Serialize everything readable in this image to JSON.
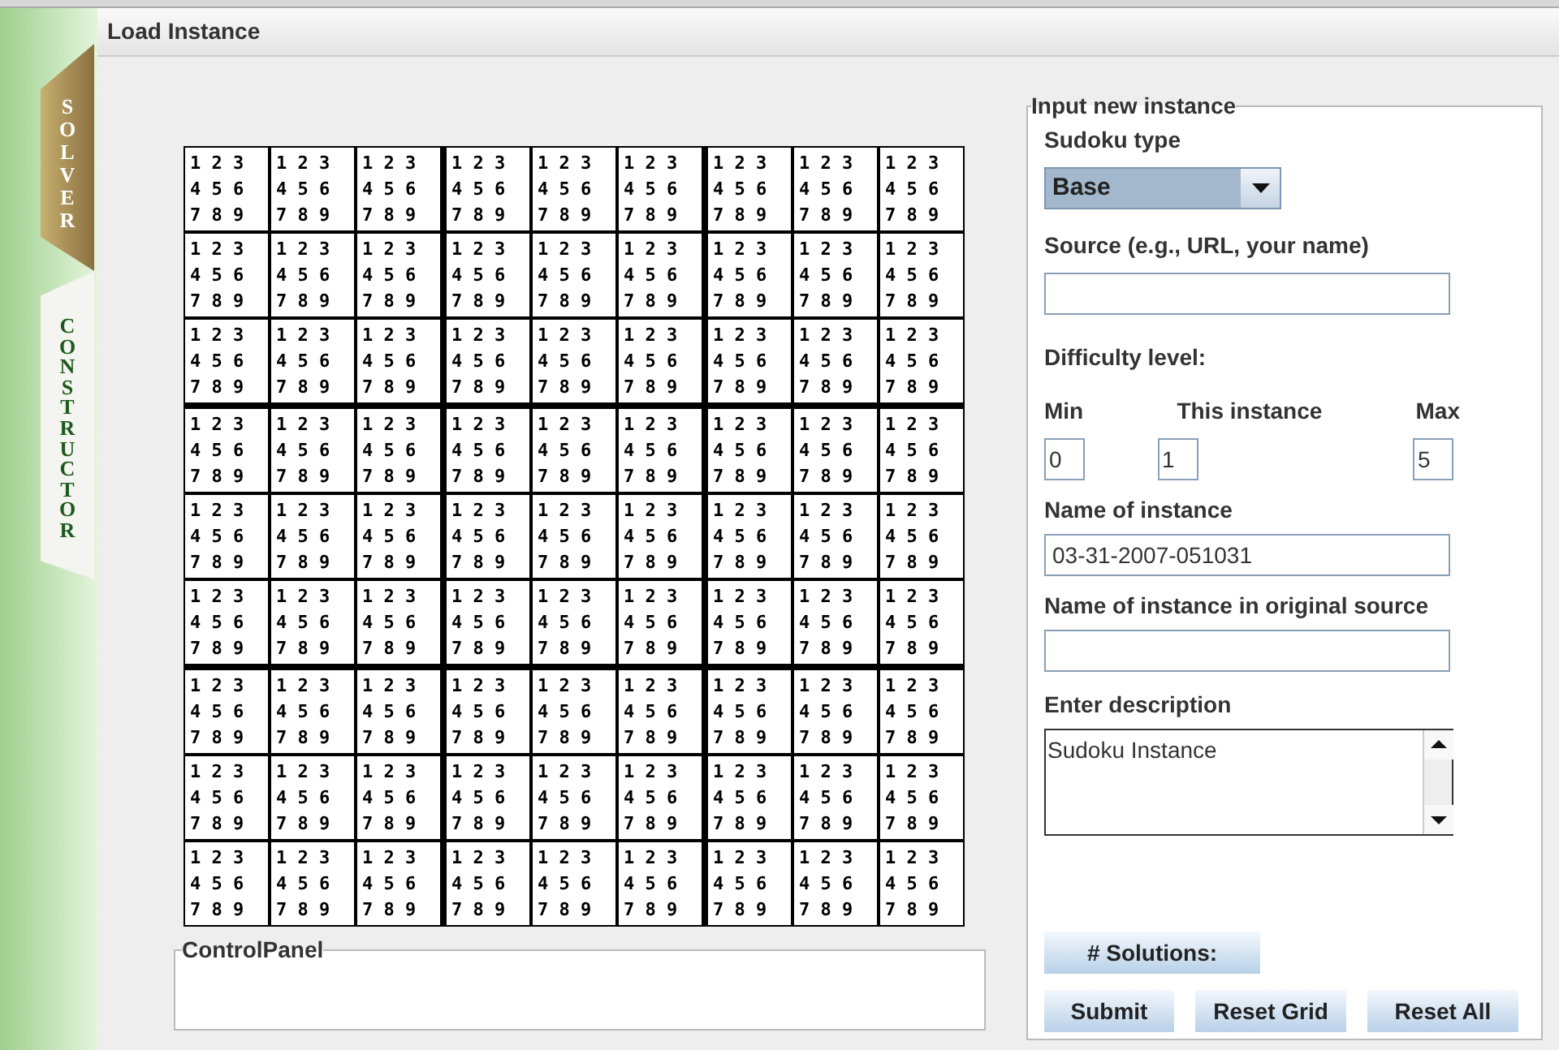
{
  "tabs": [
    {
      "label": "SOLVER",
      "selected": true
    },
    {
      "label": "CONSTRUCTOR",
      "selected": false
    }
  ],
  "header": {
    "title": "Load Instance"
  },
  "grid": {
    "rows": [
      [
        [
          "1 2 3",
          "4 5 6",
          "7 8 9"
        ],
        [
          "1 2 3",
          "4 5 6",
          "7 8 9"
        ],
        [
          "1 2 3",
          "4 5 6",
          "7 8 9"
        ],
        [
          "1 2 3",
          "4 5 6",
          "7 8 9"
        ],
        [
          "1 2 3",
          "4 5 6",
          "7 8 9"
        ],
        [
          "1 2 3",
          "4 5 6",
          "7 8 9"
        ],
        [
          "1 2 3",
          "4 5 6",
          "7 8 9"
        ],
        [
          "1 2 3",
          "4 5 6",
          "7 8 9"
        ],
        [
          "1 2 3",
          "4 5 6",
          "7 8 9"
        ]
      ],
      [
        [
          "1 2 3",
          "4 5 6",
          "7 8 9"
        ],
        [
          "1 2 3",
          "4 5 6",
          "7 8 9"
        ],
        [
          "1 2 3",
          "4 5 6",
          "7 8 9"
        ],
        [
          "1 2 3",
          "4 5 6",
          "7 8 9"
        ],
        [
          "1 2 3",
          "4 5 6",
          "7 8 9"
        ],
        [
          "1 2 3",
          "4 5 6",
          "7 8 9"
        ],
        [
          "1 2 3",
          "4 5 6",
          "7 8 9"
        ],
        [
          "1 2 3",
          "4 5 6",
          "7 8 9"
        ],
        [
          "1 2 3",
          "4 5 6",
          "7 8 9"
        ]
      ],
      [
        [
          "1 2 3",
          "4 5 6",
          "7 8 9"
        ],
        [
          "1 2 3",
          "4 5 6",
          "7 8 9"
        ],
        [
          "1 2 3",
          "4 5 6",
          "7 8 9"
        ],
        [
          "1 2 3",
          "4 5 6",
          "7 8 9"
        ],
        [
          "1 2 3",
          "4 5 6",
          "7 8 9"
        ],
        [
          "1 2 3",
          "4 5 6",
          "7 8 9"
        ],
        [
          "1 2 3",
          "4 5 6",
          "7 8 9"
        ],
        [
          "1 2 3",
          "4 5 6",
          "7 8 9"
        ],
        [
          "1 2 3",
          "4 5 6",
          "7 8 9"
        ]
      ],
      [
        [
          "1 2 3",
          "4 5 6",
          "7 8 9"
        ],
        [
          "1 2 3",
          "4 5 6",
          "7 8 9"
        ],
        [
          "1 2 3",
          "4 5 6",
          "7 8 9"
        ],
        [
          "1 2 3",
          "4 5 6",
          "7 8 9"
        ],
        [
          "1 2 3",
          "4 5 6",
          "7 8 9"
        ],
        [
          "1 2 3",
          "4 5 6",
          "7 8 9"
        ],
        [
          "1 2 3",
          "4 5 6",
          "7 8 9"
        ],
        [
          "1 2 3",
          "4 5 6",
          "7 8 9"
        ],
        [
          "1 2 3",
          "4 5 6",
          "7 8 9"
        ]
      ],
      [
        [
          "1 2 3",
          "4 5 6",
          "7 8 9"
        ],
        [
          "1 2 3",
          "4 5 6",
          "7 8 9"
        ],
        [
          "1 2 3",
          "4 5 6",
          "7 8 9"
        ],
        [
          "1 2 3",
          "4 5 6",
          "7 8 9"
        ],
        [
          "1 2 3",
          "4 5 6",
          "7 8 9"
        ],
        [
          "1 2 3",
          "4 5 6",
          "7 8 9"
        ],
        [
          "1 2 3",
          "4 5 6",
          "7 8 9"
        ],
        [
          "1 2 3",
          "4 5 6",
          "7 8 9"
        ],
        [
          "1 2 3",
          "4 5 6",
          "7 8 9"
        ]
      ],
      [
        [
          "1 2 3",
          "4 5 6",
          "7 8 9"
        ],
        [
          "1 2 3",
          "4 5 6",
          "7 8 9"
        ],
        [
          "1 2 3",
          "4 5 6",
          "7 8 9"
        ],
        [
          "1 2 3",
          "4 5 6",
          "7 8 9"
        ],
        [
          "1 2 3",
          "4 5 6",
          "7 8 9"
        ],
        [
          "1 2 3",
          "4 5 6",
          "7 8 9"
        ],
        [
          "1 2 3",
          "4 5 6",
          "7 8 9"
        ],
        [
          "1 2 3",
          "4 5 6",
          "7 8 9"
        ],
        [
          "1 2 3",
          "4 5 6",
          "7 8 9"
        ]
      ],
      [
        [
          "1 2 3",
          "4 5 6",
          "7 8 9"
        ],
        [
          "1 2 3",
          "4 5 6",
          "7 8 9"
        ],
        [
          "1 2 3",
          "4 5 6",
          "7 8 9"
        ],
        [
          "1 2 3",
          "4 5 6",
          "7 8 9"
        ],
        [
          "1 2 3",
          "4 5 6",
          "7 8 9"
        ],
        [
          "1 2 3",
          "4 5 6",
          "7 8 9"
        ],
        [
          "1 2 3",
          "4 5 6",
          "7 8 9"
        ],
        [
          "1 2 3",
          "4 5 6",
          "7 8 9"
        ],
        [
          "1 2 3",
          "4 5 6",
          "7 8 9"
        ]
      ],
      [
        [
          "1 2 3",
          "4 5 6",
          "7 8 9"
        ],
        [
          "1 2 3",
          "4 5 6",
          "7 8 9"
        ],
        [
          "1 2 3",
          "4 5 6",
          "7 8 9"
        ],
        [
          "1 2 3",
          "4 5 6",
          "7 8 9"
        ],
        [
          "1 2 3",
          "4 5 6",
          "7 8 9"
        ],
        [
          "1 2 3",
          "4 5 6",
          "7 8 9"
        ],
        [
          "1 2 3",
          "4 5 6",
          "7 8 9"
        ],
        [
          "1 2 3",
          "4 5 6",
          "7 8 9"
        ],
        [
          "1 2 3",
          "4 5 6",
          "7 8 9"
        ]
      ],
      [
        [
          "1 2 3",
          "4 5 6",
          "7 8 9"
        ],
        [
          "1 2 3",
          "4 5 6",
          "7 8 9"
        ],
        [
          "1 2 3",
          "4 5 6",
          "7 8 9"
        ],
        [
          "1 2 3",
          "4 5 6",
          "7 8 9"
        ],
        [
          "1 2 3",
          "4 5 6",
          "7 8 9"
        ],
        [
          "1 2 3",
          "4 5 6",
          "7 8 9"
        ],
        [
          "1 2 3",
          "4 5 6",
          "7 8 9"
        ],
        [
          "1 2 3",
          "4 5 6",
          "7 8 9"
        ],
        [
          "1 2 3",
          "4 5 6",
          "7 8 9"
        ]
      ]
    ]
  },
  "control_panel": {
    "title": "ControlPanel"
  },
  "input_panel": {
    "title": "Input new instance",
    "sudoku_type": {
      "label": "Sudoku type",
      "value": "Base"
    },
    "source": {
      "label": "Source (e.g., URL, your name)"
    },
    "difficulty": {
      "label": "Difficulty level:",
      "min": {
        "label": "Min",
        "value": "0"
      },
      "this": {
        "label": "This instance",
        "value": "1"
      },
      "max": {
        "label": "Max",
        "value": "5"
      }
    },
    "name": {
      "label": "Name of instance",
      "value": "03-31-2007-051031"
    },
    "original_name": {
      "label": "Name of instance in original source"
    },
    "description": {
      "label": "Enter description",
      "value": "Sudoku Instance"
    },
    "solutions_button": "# Solutions:",
    "buttons": [
      "Submit",
      "Reset Grid",
      "Reset All"
    ]
  }
}
